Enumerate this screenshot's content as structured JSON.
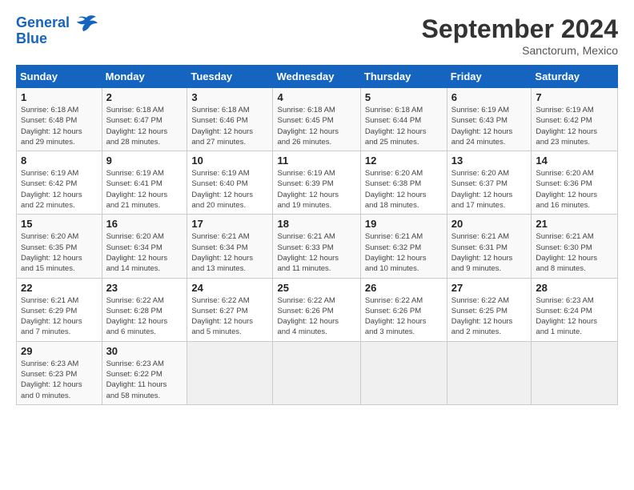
{
  "header": {
    "logo_line1": "General",
    "logo_line2": "Blue",
    "month": "September 2024",
    "location": "Sanctorum, Mexico"
  },
  "weekdays": [
    "Sunday",
    "Monday",
    "Tuesday",
    "Wednesday",
    "Thursday",
    "Friday",
    "Saturday"
  ],
  "weeks": [
    [
      {
        "day": "1",
        "info": "Sunrise: 6:18 AM\nSunset: 6:48 PM\nDaylight: 12 hours\nand 29 minutes."
      },
      {
        "day": "2",
        "info": "Sunrise: 6:18 AM\nSunset: 6:47 PM\nDaylight: 12 hours\nand 28 minutes."
      },
      {
        "day": "3",
        "info": "Sunrise: 6:18 AM\nSunset: 6:46 PM\nDaylight: 12 hours\nand 27 minutes."
      },
      {
        "day": "4",
        "info": "Sunrise: 6:18 AM\nSunset: 6:45 PM\nDaylight: 12 hours\nand 26 minutes."
      },
      {
        "day": "5",
        "info": "Sunrise: 6:18 AM\nSunset: 6:44 PM\nDaylight: 12 hours\nand 25 minutes."
      },
      {
        "day": "6",
        "info": "Sunrise: 6:19 AM\nSunset: 6:43 PM\nDaylight: 12 hours\nand 24 minutes."
      },
      {
        "day": "7",
        "info": "Sunrise: 6:19 AM\nSunset: 6:42 PM\nDaylight: 12 hours\nand 23 minutes."
      }
    ],
    [
      {
        "day": "8",
        "info": "Sunrise: 6:19 AM\nSunset: 6:42 PM\nDaylight: 12 hours\nand 22 minutes."
      },
      {
        "day": "9",
        "info": "Sunrise: 6:19 AM\nSunset: 6:41 PM\nDaylight: 12 hours\nand 21 minutes."
      },
      {
        "day": "10",
        "info": "Sunrise: 6:19 AM\nSunset: 6:40 PM\nDaylight: 12 hours\nand 20 minutes."
      },
      {
        "day": "11",
        "info": "Sunrise: 6:19 AM\nSunset: 6:39 PM\nDaylight: 12 hours\nand 19 minutes."
      },
      {
        "day": "12",
        "info": "Sunrise: 6:20 AM\nSunset: 6:38 PM\nDaylight: 12 hours\nand 18 minutes."
      },
      {
        "day": "13",
        "info": "Sunrise: 6:20 AM\nSunset: 6:37 PM\nDaylight: 12 hours\nand 17 minutes."
      },
      {
        "day": "14",
        "info": "Sunrise: 6:20 AM\nSunset: 6:36 PM\nDaylight: 12 hours\nand 16 minutes."
      }
    ],
    [
      {
        "day": "15",
        "info": "Sunrise: 6:20 AM\nSunset: 6:35 PM\nDaylight: 12 hours\nand 15 minutes."
      },
      {
        "day": "16",
        "info": "Sunrise: 6:20 AM\nSunset: 6:34 PM\nDaylight: 12 hours\nand 14 minutes."
      },
      {
        "day": "17",
        "info": "Sunrise: 6:21 AM\nSunset: 6:34 PM\nDaylight: 12 hours\nand 13 minutes."
      },
      {
        "day": "18",
        "info": "Sunrise: 6:21 AM\nSunset: 6:33 PM\nDaylight: 12 hours\nand 11 minutes."
      },
      {
        "day": "19",
        "info": "Sunrise: 6:21 AM\nSunset: 6:32 PM\nDaylight: 12 hours\nand 10 minutes."
      },
      {
        "day": "20",
        "info": "Sunrise: 6:21 AM\nSunset: 6:31 PM\nDaylight: 12 hours\nand 9 minutes."
      },
      {
        "day": "21",
        "info": "Sunrise: 6:21 AM\nSunset: 6:30 PM\nDaylight: 12 hours\nand 8 minutes."
      }
    ],
    [
      {
        "day": "22",
        "info": "Sunrise: 6:21 AM\nSunset: 6:29 PM\nDaylight: 12 hours\nand 7 minutes."
      },
      {
        "day": "23",
        "info": "Sunrise: 6:22 AM\nSunset: 6:28 PM\nDaylight: 12 hours\nand 6 minutes."
      },
      {
        "day": "24",
        "info": "Sunrise: 6:22 AM\nSunset: 6:27 PM\nDaylight: 12 hours\nand 5 minutes."
      },
      {
        "day": "25",
        "info": "Sunrise: 6:22 AM\nSunset: 6:26 PM\nDaylight: 12 hours\nand 4 minutes."
      },
      {
        "day": "26",
        "info": "Sunrise: 6:22 AM\nSunset: 6:26 PM\nDaylight: 12 hours\nand 3 minutes."
      },
      {
        "day": "27",
        "info": "Sunrise: 6:22 AM\nSunset: 6:25 PM\nDaylight: 12 hours\nand 2 minutes."
      },
      {
        "day": "28",
        "info": "Sunrise: 6:23 AM\nSunset: 6:24 PM\nDaylight: 12 hours\nand 1 minute."
      }
    ],
    [
      {
        "day": "29",
        "info": "Sunrise: 6:23 AM\nSunset: 6:23 PM\nDaylight: 12 hours\nand 0 minutes."
      },
      {
        "day": "30",
        "info": "Sunrise: 6:23 AM\nSunset: 6:22 PM\nDaylight: 11 hours\nand 58 minutes."
      },
      null,
      null,
      null,
      null,
      null
    ]
  ]
}
